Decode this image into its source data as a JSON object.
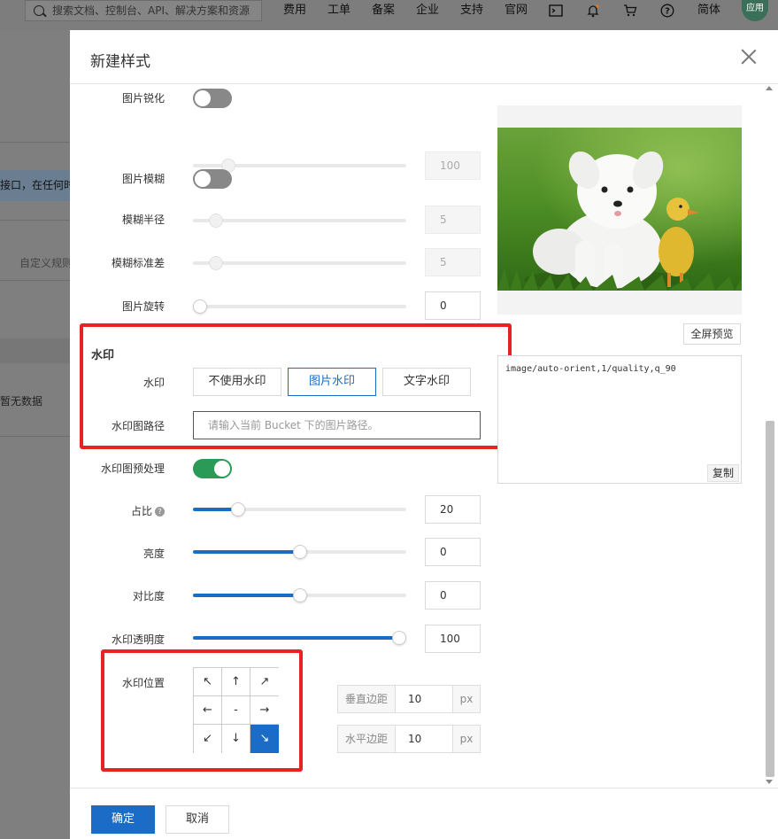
{
  "topbar": {
    "search_placeholder": "搜索文档、控制台、API、解决方案和资源",
    "nav": [
      "费用",
      "工单",
      "备案",
      "企业",
      "支持",
      "官网"
    ],
    "lang": "简体",
    "avatar_text": "应用",
    "icons": [
      "terminal-icon",
      "bell-icon",
      "cart-icon",
      "help-icon"
    ]
  },
  "background": {
    "banner_text": "接口，在任何时",
    "custom_label": "自定义规则",
    "empty_text": "暂无数据"
  },
  "modal": {
    "title": "新建样式",
    "sharpen": {
      "label": "图片锐化",
      "on": false,
      "value": "100",
      "level": 0.14
    },
    "blur": {
      "label": "图片模糊",
      "on": false
    },
    "blur_radius": {
      "label": "模糊半径",
      "value": "5",
      "level": 0.08
    },
    "blur_sigma": {
      "label": "模糊标准差",
      "value": "5",
      "level": 0.08
    },
    "rotate": {
      "label": "图片旋转",
      "value": "0",
      "level": 0.0
    },
    "watermark": {
      "section_title": "水印",
      "type_label": "水印",
      "options": [
        "不使用水印",
        "图片水印",
        "文字水印"
      ],
      "selected": "图片水印",
      "path_label": "水印图路径",
      "path_placeholder": "请输入当前 Bucket 下的图片路径。",
      "preprocess": {
        "label": "水印图预处理",
        "on": true
      },
      "ratio": {
        "label": "占比",
        "value": "20",
        "level": 0.19
      },
      "brightness": {
        "label": "亮度",
        "value": "0",
        "level": 0.5
      },
      "contrast": {
        "label": "对比度",
        "value": "0",
        "level": 0.5
      },
      "opacity": {
        "label": "水印透明度",
        "value": "100",
        "level": 1.0
      },
      "position": {
        "label": "水印位置",
        "cells": [
          "↖",
          "↑",
          "↗",
          "←",
          "-",
          "→",
          "↙",
          "↓",
          "↘"
        ],
        "selected": 8
      },
      "vertical_margin": {
        "label": "垂直边距",
        "value": "10",
        "unit": "px"
      },
      "horizontal_margin": {
        "label": "水平边距",
        "value": "10",
        "unit": "px"
      }
    },
    "preview": {
      "fullscreen_label": "全屏预览",
      "code": "image/auto-orient,1/quality,q_90",
      "copy_label": "复制"
    },
    "footer": {
      "ok_label": "确定",
      "cancel_label": "取消"
    }
  },
  "colors": {
    "primary": "#1a6cc6",
    "toggle_on": "#2b9a56",
    "highlight_box": "#e62222"
  }
}
